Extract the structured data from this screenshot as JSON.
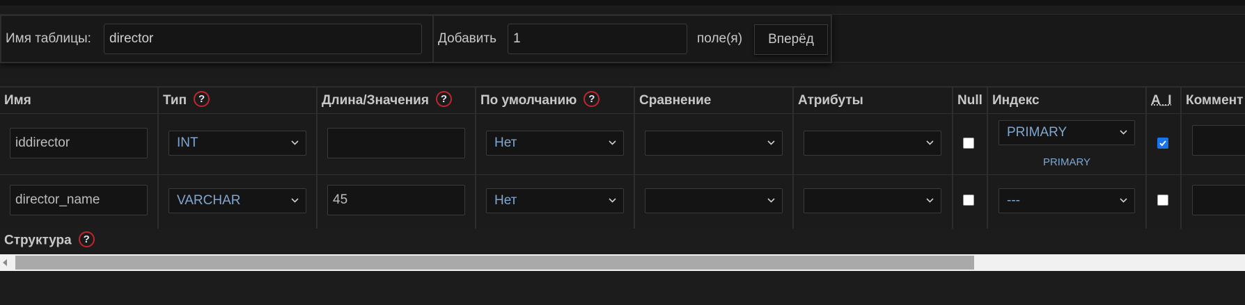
{
  "table_name": {
    "label": "Имя таблицы:",
    "value": "director"
  },
  "add_fields": {
    "label": "Добавить",
    "value": "1",
    "suffix": "поле(я)",
    "go_label": "Вперёд"
  },
  "columns": {
    "name": "Имя",
    "type": "Тип",
    "length": "Длина/Значения",
    "default": "По умолчанию",
    "collation": "Сравнение",
    "attributes": "Атрибуты",
    "null": "Null",
    "index": "Индекс",
    "ai": "A_I",
    "comment": "Коммент"
  },
  "rows": [
    {
      "name": "iddirector",
      "type": "INT",
      "length": "",
      "default": "Нет",
      "collation": "",
      "attributes": "",
      "null": false,
      "index": "PRIMARY",
      "index_note": "PRIMARY",
      "ai": true
    },
    {
      "name": "director_name",
      "type": "VARCHAR",
      "length": "45",
      "default": "Нет",
      "collation": "",
      "attributes": "",
      "null": false,
      "index": "---",
      "ai": false
    }
  ],
  "structure_label": "Структура",
  "help_icon_char": "?",
  "colors": {
    "background": "#1c1c1c",
    "select_text": "#7ea7d3",
    "help_ring": "#c0272d",
    "checkbox_checked": "#1a73e8"
  },
  "scroll": {
    "position_fraction": 0.0,
    "visible_fraction": 0.77
  }
}
